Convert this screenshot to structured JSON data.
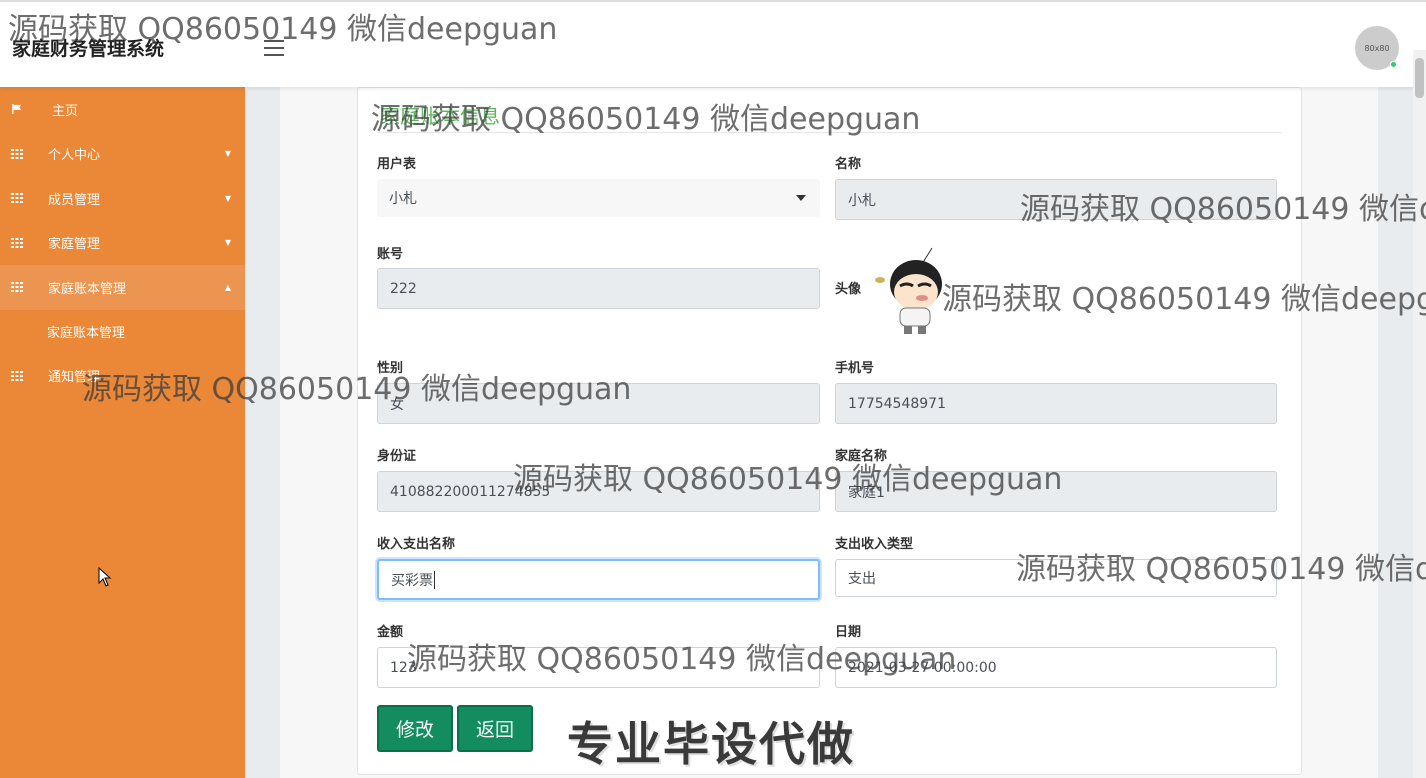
{
  "header": {
    "app_title": "家庭财务管理系统",
    "avatar_text": "80x80"
  },
  "sidebar": {
    "items": [
      {
        "label": "主页",
        "icon": "flag-icon"
      },
      {
        "label": "个人中心",
        "icon": "grid-icon"
      },
      {
        "label": "成员管理",
        "icon": "grid-icon"
      },
      {
        "label": "家庭管理",
        "icon": "grid-icon"
      },
      {
        "label": "家庭账本管理",
        "icon": "grid-icon",
        "expanded": true
      },
      {
        "label": "通知管理",
        "icon": "grid-icon"
      }
    ],
    "sub_items": [
      {
        "label": "家庭账本管理"
      }
    ]
  },
  "form": {
    "title": "家庭账本信息",
    "user_table_label": "用户表",
    "user_table_value": "小札",
    "name_label": "名称",
    "name_value": "小札",
    "account_label": "账号",
    "account_value": "222",
    "avatar_label": "头像",
    "gender_label": "性别",
    "gender_value": "女",
    "phone_label": "手机号",
    "phone_value": "17754548971",
    "id_card_label": "身份证",
    "id_card_value": "410882200011274855",
    "family_name_label": "家庭名称",
    "family_name_value": "家庭1",
    "io_name_label": "收入支出名称",
    "io_name_value": "买彩票",
    "io_type_label": "支出收入类型",
    "io_type_value": "支出",
    "amount_label": "金额",
    "amount_value": "123",
    "date_label": "日期",
    "date_value": "2021-03-27 00:00:00",
    "modify_button": "修改",
    "back_button": "返回"
  },
  "watermarks": [
    "源码获取 QQ86050149 微信deepguan",
    "源码获取 QQ86050149 微信deepguan",
    "源码获取 QQ86050149 微信d",
    "源码获取 QQ86050149 微信deepgu",
    "源码获取 QQ86050149 微信deepguan",
    "源码获取 QQ86050149 微信deepguan",
    "源码获取 QQ86050149 微信d",
    "源码获取 QQ86050149 微信deepguan"
  ],
  "promo_text": "专业毕设代做",
  "colors": {
    "sidebar": "#ea8838",
    "button": "#138d5f",
    "title_green": "#5cb85c"
  }
}
